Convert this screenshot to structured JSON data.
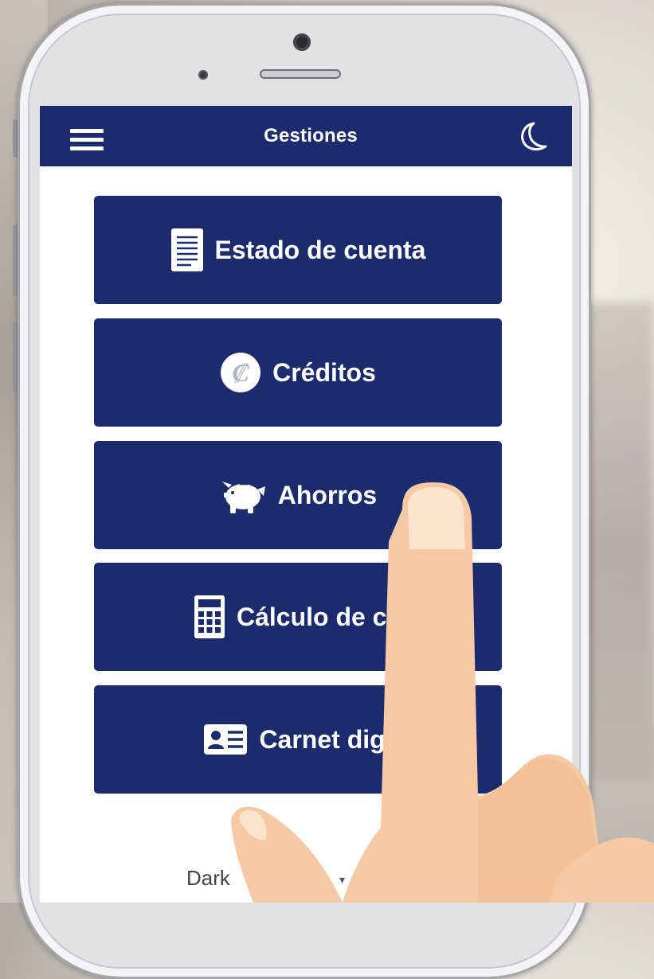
{
  "header": {
    "title": "Gestiones",
    "menu_icon": "hamburger-menu-icon",
    "theme_icon": "moon-icon"
  },
  "menu": [
    {
      "label": "Estado de cuenta",
      "icon": "document-icon"
    },
    {
      "label": "Créditos",
      "icon": "colon-currency-icon",
      "icon_glyph": "₡"
    },
    {
      "label": "Ahorros",
      "icon": "piggy-bank-icon"
    },
    {
      "label": "Cálculo de cu",
      "icon": "calculator-icon"
    },
    {
      "label": "Carnet digi",
      "icon": "id-card-icon"
    }
  ],
  "footer": {
    "text": "Dark"
  },
  "colors": {
    "primary": "#1b2b6e",
    "background": "#ffffff",
    "hand": "#f5c9a4",
    "fingernail": "#fbe4cf"
  }
}
